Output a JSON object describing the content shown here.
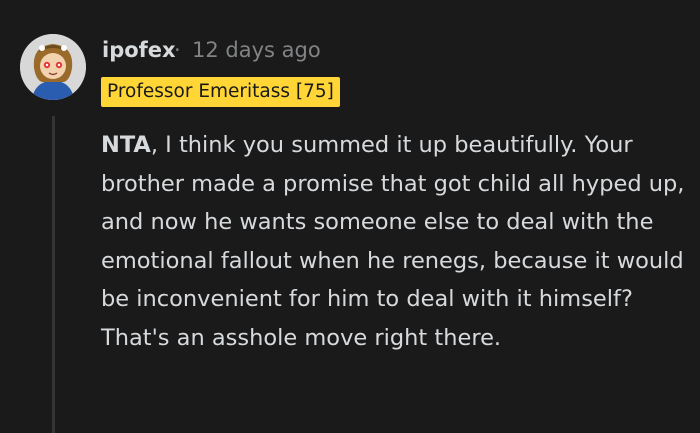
{
  "comment": {
    "author": "ipofex",
    "separator": "·",
    "timestamp": "12 days ago",
    "flair": "Professor Emeritass [75]",
    "body_bold": "NTA",
    "body_text": ", I think you summed it up beautifully. Your brother made a promise that got child all hyped up, and now he wants someone else to deal with the emotional fallout when he renegs, because it would be inconvenient for him to deal with it himself? That's an asshole move right there."
  },
  "colors": {
    "background": "#1a1a1b",
    "text": "#d7dadc",
    "muted": "#818384",
    "flair_bg": "#ffd635",
    "thread_line": "#343536"
  },
  "icons": {
    "avatar": "user-avatar-icon"
  }
}
